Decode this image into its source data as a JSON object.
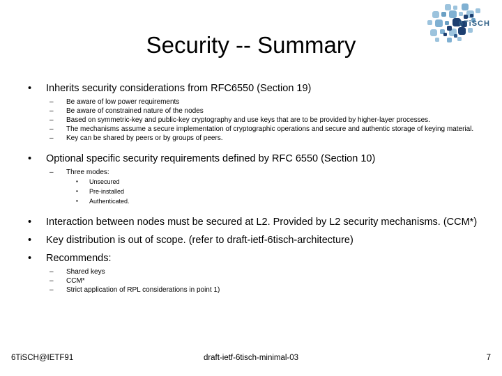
{
  "slide": {
    "title": "Security -- Summary",
    "logo": {
      "wordmark": "6TiSCH",
      "colors": {
        "light": "#9cc3dd",
        "mid": "#6ba0c4",
        "medium": "#4a7fa8",
        "dark": "#1d3f70",
        "wordmark": "#2e5f86"
      }
    },
    "content": [
      {
        "level": 1,
        "marker": "•",
        "text": "Inherits security considerations from RFC6550 (Section 19)"
      },
      {
        "level": 2,
        "marker": "–",
        "text": "Be aware of low power requirements"
      },
      {
        "level": 2,
        "marker": "–",
        "text": "Be aware of constrained nature of the nodes"
      },
      {
        "level": 2,
        "marker": "–",
        "text": "Based on symmetric-key and public-key cryptography and use keys that are to be provided by higher-layer processes."
      },
      {
        "level": 2,
        "marker": "–",
        "text": "The mechanisms assume  a secure implementation of cryptographic operations and secure and authentic storage of keying material."
      },
      {
        "level": 2,
        "marker": "–",
        "text": "Key can be shared by peers or by groups of peers."
      },
      {
        "level": 1,
        "marker": "•",
        "text": "Optional specific security requirements defined by RFC 6550 (Section 10)"
      },
      {
        "level": 2,
        "marker": "–",
        "text": "Three modes:"
      },
      {
        "level": 3,
        "marker": "▪",
        "text": "Unsecured"
      },
      {
        "level": 3,
        "marker": "▪",
        "text": "Pre-installed"
      },
      {
        "level": 3,
        "marker": "▪",
        "text": "Authenticated."
      },
      {
        "level": 1,
        "marker": "•",
        "text": "Interaction between nodes must be secured at L2. Provided by L2 security mechanisms. (CCM*)"
      },
      {
        "level": 1,
        "marker": "•",
        "text": "Key distribution is out of scope. (refer to draft-ietf-6tisch-architecture)"
      },
      {
        "level": 1,
        "marker": "•",
        "text": "Recommends:"
      },
      {
        "level": 2,
        "marker": "–",
        "text": "Shared keys"
      },
      {
        "level": 2,
        "marker": "–",
        "text": "CCM*"
      },
      {
        "level": 2,
        "marker": "–",
        "text": "Strict application of RPL considerations in point 1)"
      }
    ],
    "footer": {
      "left": "6TiSCH@IETF91",
      "center": "draft-ietf-6tisch-minimal-03",
      "page_number": "7"
    }
  }
}
